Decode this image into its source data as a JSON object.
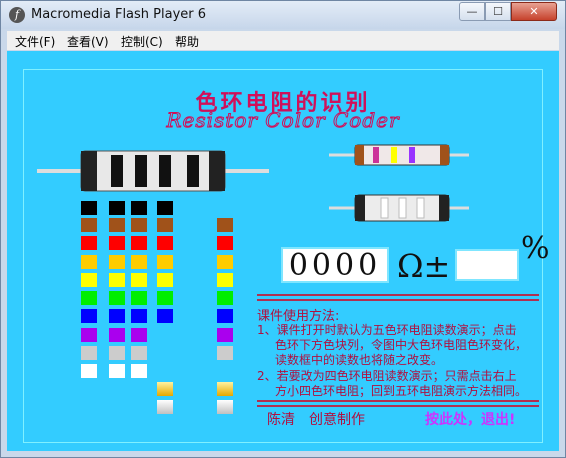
{
  "window": {
    "title": "Macromedia Flash Player 6"
  },
  "menu": [
    "文件(F)",
    "查看(V)",
    "控制(C)",
    "帮助"
  ],
  "title_cn": "色环电阻的识别",
  "title_en": "Resistor Color Coder",
  "display": {
    "value": "0000",
    "ohm": "Ω±",
    "percent": "%"
  },
  "instructions": {
    "heading": "课件使用方法:",
    "line1": "1、课件打开时默认为五色环电阻读数演示；点击",
    "line2": "色环下方色块列，令图中大色环电阻色环变化，",
    "line3": "读数框中的读数也将随之改变。",
    "line4": "2、若要改为四色环电阻读数演示；只需点击右上",
    "line5": "方小四色环电阻；回到五环电阻演示方法相同。"
  },
  "footer": {
    "author": "陈清　创意制作",
    "exit": "按此处，退出!"
  },
  "colors": {
    "stage": "#33ccff",
    "accent": "#d0105a",
    "exit": "#cc33ff"
  },
  "palette": [
    "black",
    "brown",
    "red",
    "orange",
    "yellow",
    "green",
    "blue",
    "violet",
    "gray",
    "white",
    "gold",
    "silver"
  ]
}
